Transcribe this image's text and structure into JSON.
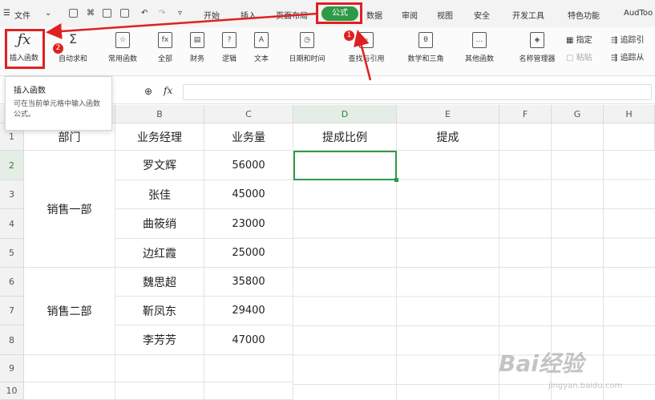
{
  "menubar": {
    "file": "文件",
    "tabs": [
      "开始",
      "插入",
      "页面布局",
      "公式",
      "数据",
      "审阅",
      "视图",
      "安全",
      "开发工具",
      "特色功能",
      "AudToo"
    ]
  },
  "ribbon": {
    "insert_function": "插入函数",
    "buttons": [
      "自动求和",
      "常用函数",
      "全部",
      "财务",
      "逻辑",
      "文本",
      "日期和时间",
      "查找与引用",
      "数学和三角",
      "其他函数",
      "名称管理器"
    ],
    "side": [
      "指定",
      "粘贴",
      "追踪引",
      "追踪从"
    ]
  },
  "badges": [
    "1",
    "2"
  ],
  "tooltip": {
    "title": "插入函数",
    "desc": "可在当前单元格中输入函数公式。"
  },
  "formula_bar": {
    "fx": "fx",
    "value": ""
  },
  "columns": [
    "B",
    "C",
    "D",
    "E",
    "F",
    "G",
    "H"
  ],
  "rows": [
    "1",
    "2",
    "3",
    "4",
    "5",
    "6",
    "7",
    "8",
    "9",
    "10"
  ],
  "headers": {
    "dept": "部门",
    "manager": "业务经理",
    "volume": "业务量",
    "ratio": "提成比例",
    "commission": "提成"
  },
  "groups": [
    "销售一部",
    "销售二部"
  ],
  "managers": [
    "罗文辉",
    "张佳",
    "曲筱绡",
    "边红霞",
    "魏思超",
    "靳凤东",
    "李芳芳"
  ],
  "volumes": [
    "56000",
    "45000",
    "23000",
    "25000",
    "35800",
    "29400",
    "47000"
  ],
  "watermark": {
    "brand": "Bai经验",
    "url": "jingyan.baidu.com"
  },
  "colors": {
    "accent": "#2e9a46",
    "annotation": "#e02020"
  }
}
